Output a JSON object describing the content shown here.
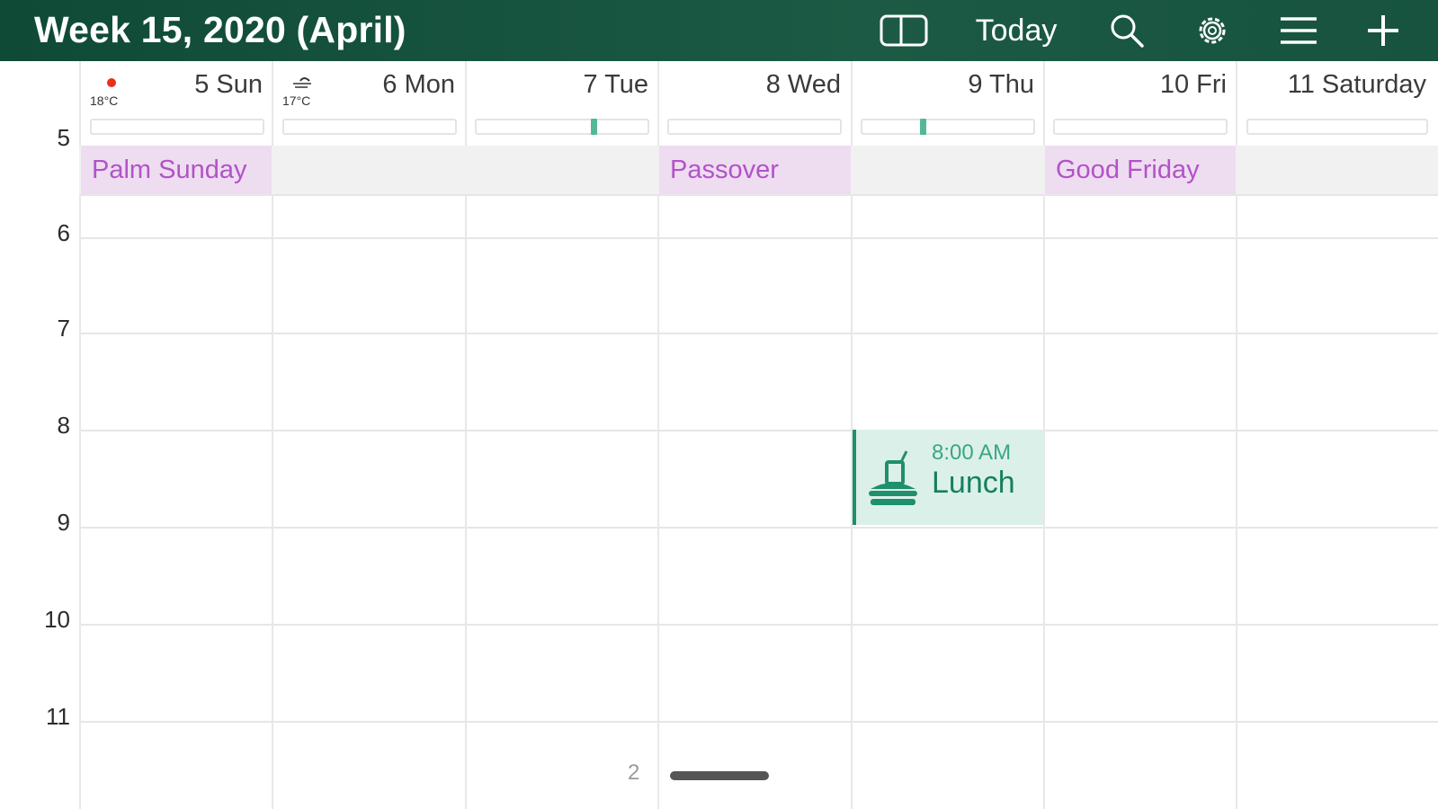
{
  "header": {
    "title": "Week 15, 2020 (April)",
    "today_label": "Today",
    "icons": {
      "split_view": "sidebar-toggle-icon",
      "search": "search-icon",
      "settings": "gear-icon",
      "menu": "hamburger-menu-icon",
      "add": "plus-icon"
    }
  },
  "days": [
    {
      "label": "5 Sun",
      "weather_icon": "sun-icon",
      "temp": "18°C"
    },
    {
      "label": "6 Mon",
      "weather_icon": "wind-cloud-icon",
      "temp": "17°C"
    },
    {
      "label": "7 Tue"
    },
    {
      "label": "8 Wed"
    },
    {
      "label": "9 Thu"
    },
    {
      "label": "10 Fri"
    },
    {
      "label": "11 Saturday"
    }
  ],
  "holidays": [
    {
      "day": "5 Sun",
      "name": "Palm Sunday"
    },
    {
      "day": "8 Wed",
      "name": "Passover"
    },
    {
      "day": "10 Fri",
      "name": "Good Friday"
    }
  ],
  "hours": [
    "5",
    "6",
    "7",
    "8",
    "9",
    "10",
    "11"
  ],
  "events": [
    {
      "day": "9 Thu",
      "time": "8:00 AM",
      "title": "Lunch",
      "icon": "lunch-food-icon"
    }
  ],
  "page_indicator": "2",
  "colors": {
    "header_bg": "#17533f",
    "holiday_bg": "#eedcf1",
    "holiday_text": "#b253c7",
    "event_bg": "#dcf0ea",
    "event_accent": "#1f8f6c",
    "allday_band": "#f1f1f1"
  }
}
